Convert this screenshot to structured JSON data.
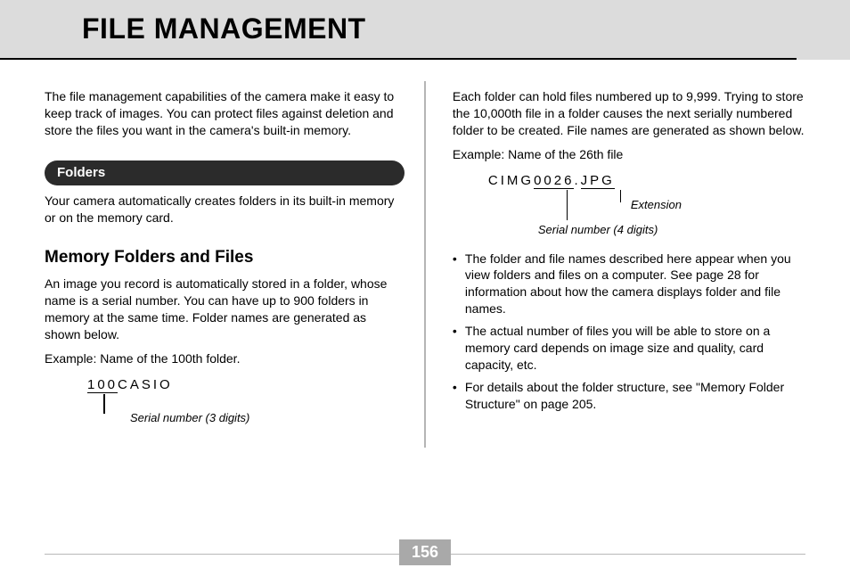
{
  "header": {
    "title": "FILE MANAGEMENT"
  },
  "left": {
    "intro": "The file management capabilities of the camera make it easy to keep track of images. You can protect files against deletion and store the files you want in the camera's built-in memory.",
    "pill": "Folders",
    "folders_text": "Your camera automatically creates folders in its built-in memory or on the memory card.",
    "subhead": "Memory Folders and Files",
    "para": "An image you record is automatically stored in a folder, whose name is a serial number. You can have up to 900 folders in memory at the same time. Folder names are generated as shown below.",
    "example_label": "Example: Name of the 100th folder.",
    "diagram": {
      "serial": "100",
      "rest": "CASIO",
      "serial_label": "Serial number (3 digits)"
    }
  },
  "right": {
    "para1": "Each folder can hold files numbered up to 9,999. Trying to store the 10,000th file in a folder causes the next serially numbered folder to be created. File names are generated as shown below.",
    "example_label": "Example: Name of the 26th file",
    "diagram": {
      "prefix": "CIMG",
      "serial": "0026",
      "dot": ".",
      "ext": "JPG",
      "ext_label": "Extension",
      "serial_label": "Serial number (4 digits)"
    },
    "bullets": [
      "The folder and file names described here appear when you view folders and files on a computer. See page 28 for information about how the camera displays folder and file names.",
      "The actual number of files you will be able to store on a memory card depends on image size and quality, card capacity, etc.",
      "For details about the folder structure, see \"Memory Folder Structure\" on page 205."
    ]
  },
  "page_number": "156"
}
